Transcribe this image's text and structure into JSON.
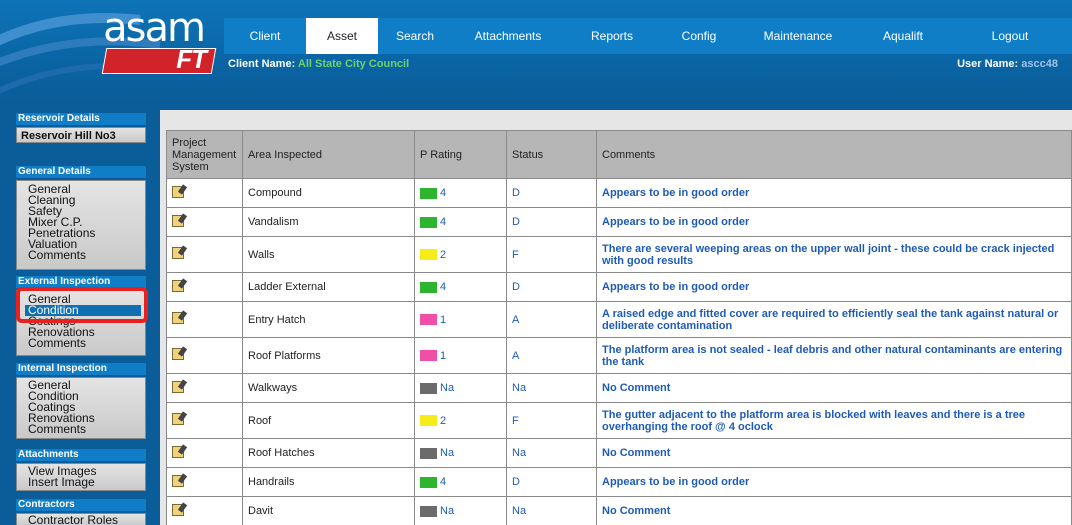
{
  "logo": {
    "brand": "asam",
    "sub": "FT"
  },
  "nav": {
    "tabs": [
      "Client",
      "Asset",
      "Search",
      "Attachments",
      "Reports",
      "Config",
      "Maintenance",
      "Aqualift",
      "Logout"
    ],
    "active": "Asset"
  },
  "header": {
    "client_label": "Client Name:",
    "client_value": "All State City Council",
    "user_label": "User Name:",
    "user_value": "ascc48"
  },
  "sidebar": {
    "reservoir_head": "Reservoir Details",
    "reservoir_name": "Reservoir Hill No3",
    "general_head": "General Details",
    "general_items": [
      "General",
      "Cleaning",
      "Safety",
      "Mixer C.P.",
      "Penetrations",
      "Valuation",
      "Comments"
    ],
    "external_head": "External Inspection",
    "external_items": [
      "General",
      "Condition",
      "Coatings",
      "Renovations",
      "Comments"
    ],
    "external_selected": "Condition",
    "internal_head": "Internal Inspection",
    "internal_items": [
      "General",
      "Condition",
      "Coatings",
      "Renovations",
      "Comments"
    ],
    "attachments_head": "Attachments",
    "attachments_items": [
      "View Images",
      "Insert Image"
    ],
    "contractors_head": "Contractors",
    "contractors_items": [
      "Contractor Roles"
    ]
  },
  "table": {
    "headers": [
      "Project Management System",
      "Area Inspected",
      "P Rating",
      "Status",
      "Comments"
    ],
    "colors": {
      "green": "#2db52d",
      "yellow": "#f5ec1a",
      "pink": "#ef4fa6",
      "gray": "#6b6b6b"
    },
    "rows": [
      {
        "area": "Compound",
        "rating": "4",
        "color": "green",
        "status": "D",
        "comment": "Appears to be in good order"
      },
      {
        "area": "Vandalism",
        "rating": "4",
        "color": "green",
        "status": "D",
        "comment": "Appears to be in good order"
      },
      {
        "area": "Walls",
        "rating": "2",
        "color": "yellow",
        "status": "F",
        "comment": "There are several weeping areas on the upper wall joint - these could be crack injected with good results"
      },
      {
        "area": "Ladder External",
        "rating": "4",
        "color": "green",
        "status": "D",
        "comment": "Appears to be in good order"
      },
      {
        "area": "Entry Hatch",
        "rating": "1",
        "color": "pink",
        "status": "A",
        "comment": "A raised edge and fitted cover are required to efficiently seal the tank against natural or deliberate contamination"
      },
      {
        "area": "Roof Platforms",
        "rating": "1",
        "color": "pink",
        "status": "A",
        "comment": "The platform area is not sealed - leaf debris and other natural contaminants are entering the tank"
      },
      {
        "area": "Walkways",
        "rating": "Na",
        "color": "gray",
        "status": "Na",
        "comment": "No Comment"
      },
      {
        "area": "Roof",
        "rating": "2",
        "color": "yellow",
        "status": "F",
        "comment": "The gutter adjacent to the platform area is blocked with leaves and there is a tree overhanging the roof @ 4 oclock"
      },
      {
        "area": "Roof Hatches",
        "rating": "Na",
        "color": "gray",
        "status": "Na",
        "comment": "No Comment"
      },
      {
        "area": "Handrails",
        "rating": "4",
        "color": "green",
        "status": "D",
        "comment": "Appears to be in good order"
      },
      {
        "area": "Davit",
        "rating": "Na",
        "color": "gray",
        "status": "Na",
        "comment": "No Comment"
      }
    ]
  }
}
